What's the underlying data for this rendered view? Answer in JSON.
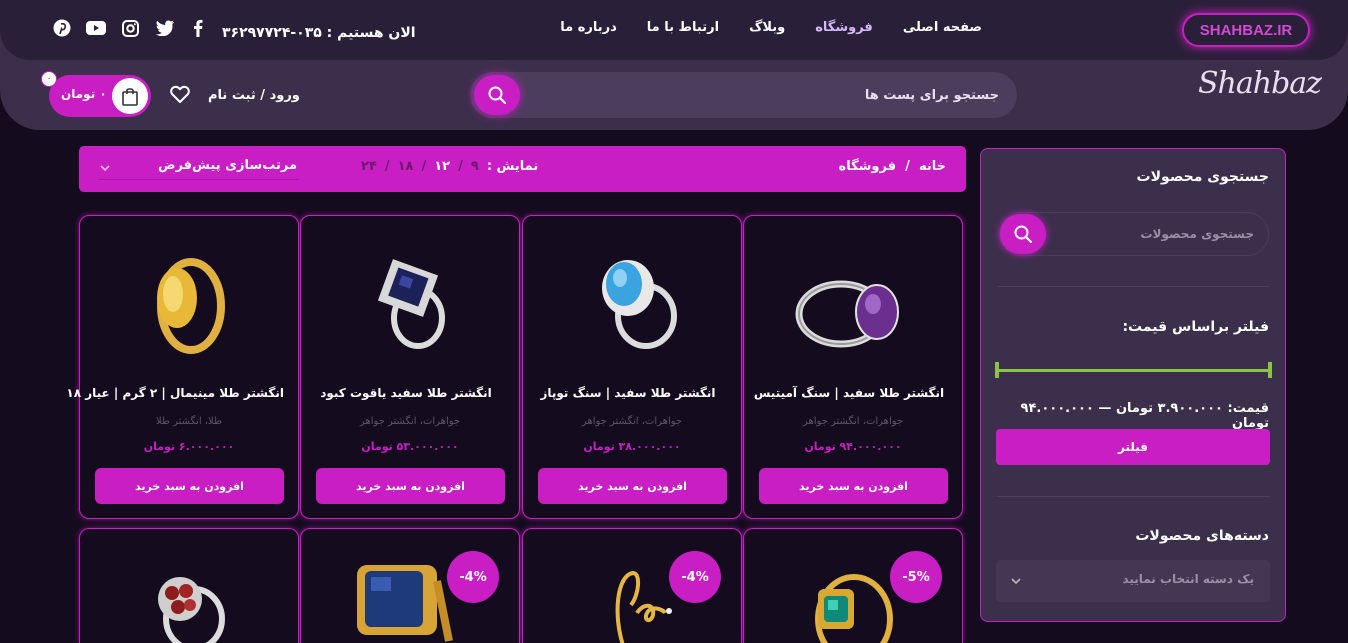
{
  "header": {
    "brand_badge": "SHAHBAZ.IR",
    "logo": "Shahbaz",
    "nav": [
      "صفحه اصلی",
      "فروشگاه",
      "وبلاگ",
      "ارتباط با ما",
      "درباره ما"
    ],
    "phone": "الان هستیم : ۰۳۵-۳۶۲۹۷۷۲۴",
    "socials": [
      "facebook-icon",
      "twitter-icon",
      "instagram-icon",
      "youtube-icon",
      "pinterest-icon"
    ],
    "search_placeholder": "جستجو برای پست ها",
    "login": "ورود / ثبت نام",
    "cart_total": "۰ تومان",
    "cart_count": "۰"
  },
  "toolbar": {
    "breadcrumb_home": "خانه",
    "breadcrumb_sep": "/",
    "breadcrumb_current": "فروشگاه",
    "show_label": "نمایش :",
    "show_options": [
      "۹",
      "۱۲",
      "۱۸",
      "۲۴"
    ],
    "show_sep": "/",
    "sort_label": "مرتب‌سازی پیش‌فرض"
  },
  "sidebar": {
    "search_title": "جستجوی محصولات",
    "search_placeholder": "جستجوی محصولات",
    "filter_title": "فیلتر براساس قیمت:",
    "price_range": "قیمت: ۳.۹۰۰.۰۰۰ تومان — ۹۴.۰۰۰.۰۰۰ تومان",
    "filter_button": "فیلتر",
    "categories_title": "دسته‌های محصولات",
    "categories_select": "یک دسته انتخاب نمایید"
  },
  "products": [
    {
      "title": "انگشتر طلا سفید | سنگ آمیتیس",
      "cats": "جواهرات، انگشتر جواهر",
      "price": "۹۴.۰۰۰.۰۰۰ تومان",
      "add": "افزودن به سبد خرید"
    },
    {
      "title": "انگشتر طلا سفید | سنگ توپاز",
      "cats": "جواهرات، انگشتر جواهر",
      "price": "۳۸.۰۰۰.۰۰۰ تومان",
      "add": "افزودن به سبد خرید"
    },
    {
      "title": "انگشتر طلا سفید یاقوت کبود",
      "cats": "جواهرات، انگشتر جواهر",
      "price": "۵۳.۰۰۰.۰۰۰ تومان",
      "add": "افزودن به سبد خرید"
    },
    {
      "title": "انگشتر طلا مینیمال | ۲ گرم | عیار ۱۸",
      "cats": "طلا، انگشتر طلا",
      "price": "۶.۰۰۰.۰۰۰ تومان",
      "add": "افزودن به سبد خرید"
    }
  ],
  "badges": [
    "-5%",
    "-4%",
    "-4%"
  ],
  "colors": {
    "accent": "#c81ec4",
    "bg": "#140c1e",
    "panel": "#3b2f4b",
    "slider": "#8bc34a"
  }
}
